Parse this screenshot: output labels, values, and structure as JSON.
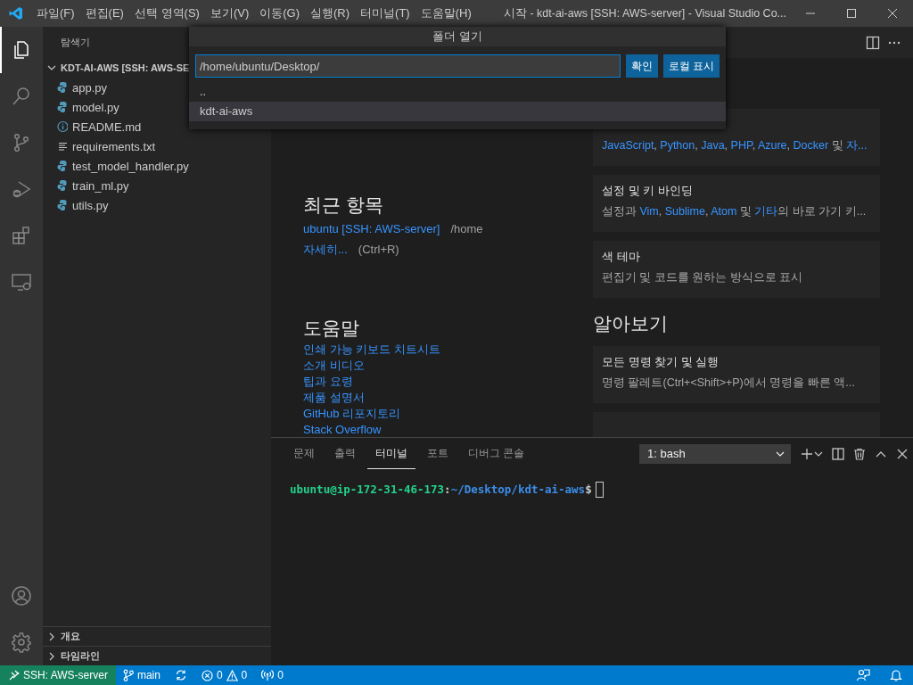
{
  "title_bar": {
    "menus": [
      "파일(F)",
      "편집(E)",
      "선택 영역(S)",
      "보기(V)",
      "이동(G)",
      "실행(R)",
      "터미널(T)",
      "도움말(H)"
    ],
    "title": "시작 - kdt-ai-aws [SSH: AWS-server] - Visual Studio Co..."
  },
  "activity_bar": {
    "items": [
      {
        "kind": "explorer",
        "selected": true
      },
      {
        "kind": "search",
        "selected": false
      },
      {
        "kind": "source-control",
        "selected": false
      },
      {
        "kind": "debug",
        "selected": false
      },
      {
        "kind": "extensions",
        "selected": false
      },
      {
        "kind": "remote",
        "selected": false
      }
    ],
    "bottom": [
      {
        "kind": "account"
      },
      {
        "kind": "settings"
      }
    ]
  },
  "sidebar": {
    "title": "탐색기",
    "folder": {
      "label": "KDT-AI-AWS [SSH: AWS-SE",
      "expanded": true,
      "children": [
        {
          "name": "app.py",
          "kind": "python"
        },
        {
          "name": "model.py",
          "kind": "python"
        },
        {
          "name": "README.md",
          "kind": "info"
        },
        {
          "name": "requirements.txt",
          "kind": "text"
        },
        {
          "name": "test_model_handler.py",
          "kind": "python"
        },
        {
          "name": "train_ml.py",
          "kind": "python"
        },
        {
          "name": "utils.py",
          "kind": "python"
        }
      ]
    },
    "sections": [
      {
        "label": "개요",
        "expanded": false
      },
      {
        "label": "타임라인",
        "expanded": false
      }
    ]
  },
  "quick_pick": {
    "title": "폴더 열기",
    "input": {
      "value": "/home/ubuntu/Desktop/"
    },
    "buttons": [
      "확인",
      "로컬 표시"
    ],
    "items": [
      {
        "label": "..",
        "selected": false
      },
      {
        "label": "kdt-ai-aws",
        "selected": true
      }
    ]
  },
  "welcome": {
    "left": [
      {
        "kind": "recent",
        "heading": "최근 항목",
        "items": [
          {
            "link": "ubuntu [SSH: AWS-server]",
            "detail": "/home"
          },
          {
            "link": "자세히...",
            "detail": "(Ctrl+R)"
          }
        ]
      },
      {
        "kind": "links",
        "heading": "도움말",
        "items": [
          "인쇄 가능 키보드 치트시트",
          "소개 비디오",
          "팁과 요령",
          "제품 설명서",
          "GitHub 리포지토리",
          "Stack Overflow"
        ]
      }
    ],
    "right": [
      {
        "kind": "card",
        "description": [
          {
            "text": "JavaScript",
            "link": true
          },
          {
            "text": ", ",
            "link": false
          },
          {
            "text": "Python",
            "link": true
          },
          {
            "text": ", ",
            "link": false
          },
          {
            "text": "Java",
            "link": true
          },
          {
            "text": ", ",
            "link": false
          },
          {
            "text": "PHP",
            "link": true
          },
          {
            "text": ", ",
            "link": false
          },
          {
            "text": "Azure",
            "link": true
          },
          {
            "text": ", ",
            "link": false
          },
          {
            "text": "Docker",
            "link": true
          },
          {
            "text": " 및 ",
            "link": false
          },
          {
            "text": "자...",
            "link": true
          }
        ]
      },
      {
        "kind": "card",
        "title": "설정 및 키 바인딩",
        "description": [
          {
            "text": "설정과 ",
            "link": false
          },
          {
            "text": "Vim",
            "link": true
          },
          {
            "text": ", ",
            "link": false
          },
          {
            "text": "Sublime",
            "link": true
          },
          {
            "text": ", ",
            "link": false
          },
          {
            "text": "Atom",
            "link": true
          },
          {
            "text": " 및 ",
            "link": false
          },
          {
            "text": "기타",
            "link": true
          },
          {
            "text": "의 바로 가기 키...",
            "link": false
          }
        ]
      },
      {
        "kind": "card",
        "title": "색 테마",
        "description": [
          {
            "text": "편집기 및 코드를 원하는 방식으로 표시",
            "link": false
          }
        ]
      },
      {
        "kind": "heading",
        "text": "알아보기"
      },
      {
        "kind": "card",
        "title": "모든 명령 찾기 및 실행",
        "description": [
          {
            "text": "명령 팔레트(Ctrl+<Shift>+P)에서 명령을 빠른 액...",
            "link": false
          }
        ]
      },
      {
        "kind": "card"
      }
    ]
  },
  "panel": {
    "tabs": [
      {
        "label": "문제",
        "selected": false
      },
      {
        "label": "출력",
        "selected": false
      },
      {
        "label": "터미널",
        "selected": true
      },
      {
        "label": "포트",
        "selected": false
      },
      {
        "label": "디버그 콘솔",
        "selected": false
      }
    ],
    "terminal_select": "1: bash",
    "prompt": [
      {
        "text": "ubuntu@ip-172-31-46-173",
        "color": "#23d18b"
      },
      {
        "text": ":",
        "color": "#cccccc"
      },
      {
        "text": "~/Desktop/kdt-ai-aws",
        "color": "#3b8eea"
      },
      {
        "text": "$",
        "color": "#cccccc"
      }
    ]
  },
  "status_bar": {
    "remote": "SSH: AWS-server",
    "branch": "main",
    "errors": "0",
    "warnings": "0",
    "ports": "0"
  }
}
